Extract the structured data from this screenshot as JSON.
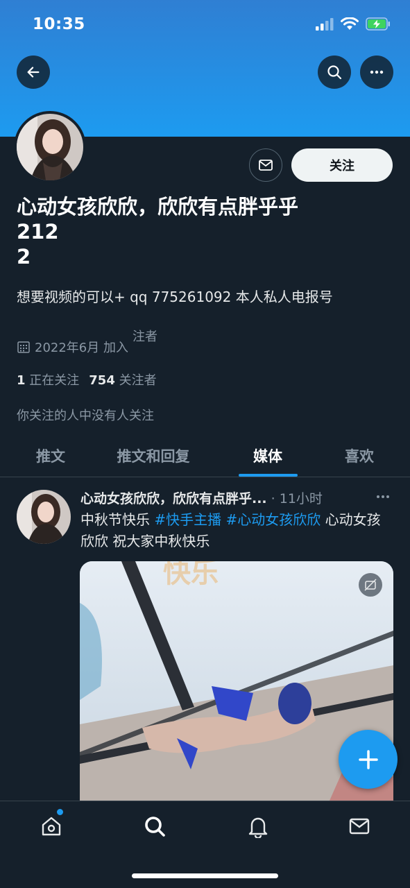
{
  "status_bar": {
    "time": "10:35"
  },
  "profile": {
    "display_name_line1": "心动女孩欣欣，欣欣有点胖乎乎",
    "display_name_line2": "212",
    "display_name_line3": "2",
    "follow_label": "关注",
    "bio": "想要视频的可以+ qq 775261092 本人私人电报号",
    "joined": "2022年6月 加入",
    "joined_overlay": "注者",
    "following_count": "1",
    "following_label": "正在关注",
    "followers_count": "754",
    "followers_label": "关注者",
    "mutuals_text": "你关注的人中没有人关注"
  },
  "tabs": [
    {
      "label": "推文"
    },
    {
      "label": "推文和回复"
    },
    {
      "label": "媒体"
    },
    {
      "label": "喜欢"
    }
  ],
  "tweet": {
    "name": "心动女孩欣欣，欣欣有点胖乎...",
    "time": "· 11小时",
    "text_1": "中秋节快乐 ",
    "hashtag_1": "#快手主播",
    "text_2": " ",
    "hashtag_2": "#心动女孩欣欣",
    "text_3": " 心动女孩欣欣 祝大家中秋快乐",
    "media_caption": "快乐"
  },
  "colors": {
    "accent": "#1d9bf0",
    "background": "#15202b",
    "banner": "#1d9bf0"
  },
  "icons": [
    "back-arrow-icon",
    "search-icon",
    "more-icon",
    "mail-icon",
    "calendar-icon",
    "compose-plus-icon",
    "home-icon",
    "bell-icon",
    "envelope-icon"
  ]
}
